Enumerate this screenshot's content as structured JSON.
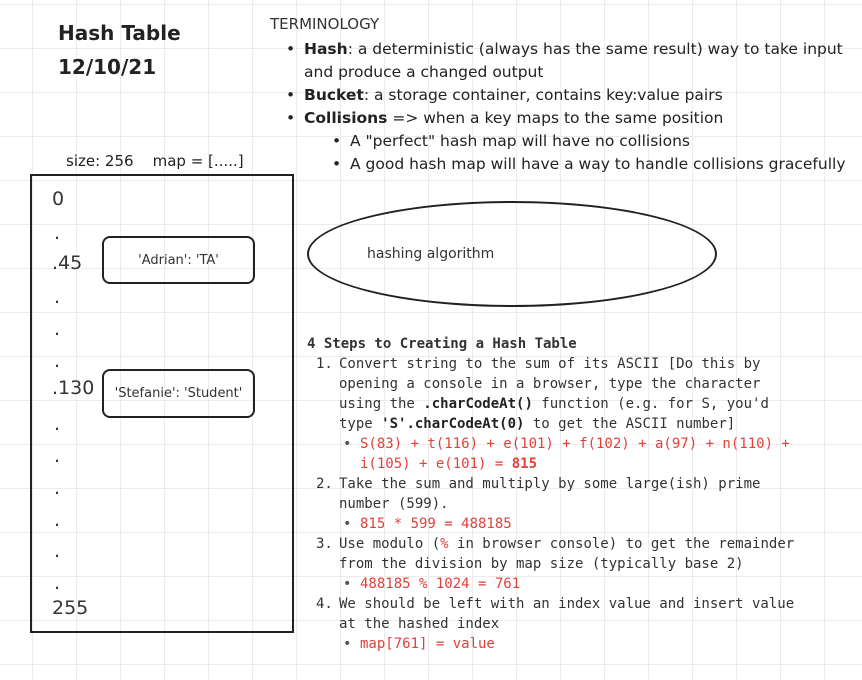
{
  "header": {
    "title": "Hash Table",
    "date": "12/10/21"
  },
  "terminology": {
    "heading": "TERMINOLOGY",
    "items": [
      {
        "term": "Hash",
        "def": ": a deterministic (always has the same result) way to take input and produce a changed output"
      },
      {
        "term": "Bucket",
        "def": ": a storage container, contains key:value pairs"
      },
      {
        "term": "Collisions",
        "def": " => when a key maps to the same position"
      }
    ],
    "sub_items": [
      "A \"perfect\" hash map will have no collisions",
      "A good hash map will have a way to handle collisions gracefully"
    ]
  },
  "table": {
    "size_label": "size: 256    map = [.....]",
    "idx_0": "0",
    "idx_45": ".45",
    "idx_130": ".130",
    "idx_255": "255",
    "dot": ".",
    "entry_1": "'Adrian': 'TA'",
    "entry_2": "'Stefanie': 'Student'"
  },
  "algorithm_label": "hashing algorithm",
  "steps": {
    "heading": "4 Steps to Creating a Hash Table",
    "s1_num": "1.",
    "s1_a": "Convert string to the sum of its ASCII [Do this by opening a console in a browser, type the character using the ",
    "s1_code1": ".charCodeAt()",
    "s1_b": " function (e.g. for S, you'd type ",
    "s1_code2": "'S'.charCodeAt(0)",
    "s1_c": " to get the ASCII number]",
    "s1_sub_a": "S(83) + t(116) + e(101) + f(102) + a(97) + n(110) + i(105) + e(101) = ",
    "s1_sub_total": "815",
    "s2_num": "2.",
    "s2": "Take the sum and multiply by some large(ish) prime number (599).",
    "s2_sub": "815 * 599 = 488185",
    "s3_num": "3.",
    "s3_a": "Use modulo (",
    "s3_pct": "%",
    "s3_b": " in browser console) to get the remainder from the division by map size (typically base 2)",
    "s3_sub": "488185 % 1024 = 761",
    "s4_num": "4.",
    "s4": "We should be left with an index value and insert value at the hashed index",
    "s4_sub": "map[761] = value"
  }
}
